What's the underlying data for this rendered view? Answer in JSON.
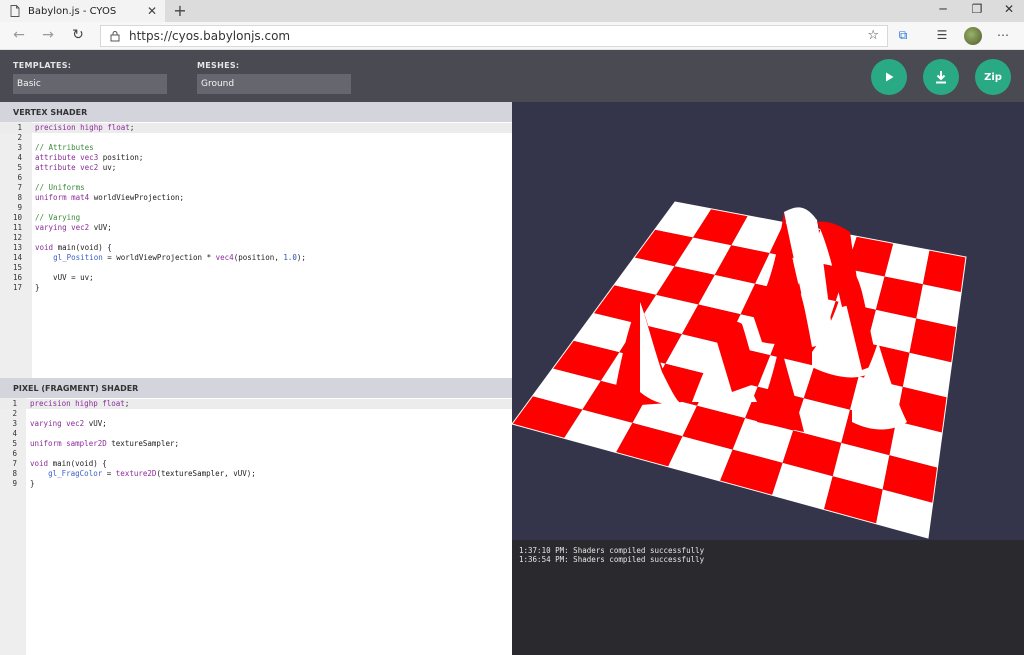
{
  "browser": {
    "tab_title": "Babylon.js - CYOS",
    "url": "https://cyos.babylonjs.com"
  },
  "header": {
    "templates_label": "TEMPLATES:",
    "templates_value": "Basic",
    "meshes_label": "MESHES:",
    "meshes_value": "Ground",
    "zip_label": "Zip"
  },
  "vertex": {
    "title": "VERTEX SHADER",
    "lines": [
      [
        {
          "t": "precision highp float",
          "c": "kw"
        },
        {
          "t": ";"
        }
      ],
      [],
      [
        {
          "t": "// Attributes",
          "c": "cm"
        }
      ],
      [
        {
          "t": "attribute vec3",
          "c": "kw"
        },
        {
          "t": " position;"
        }
      ],
      [
        {
          "t": "attribute vec2",
          "c": "kw"
        },
        {
          "t": " uv;"
        }
      ],
      [],
      [
        {
          "t": "// Uniforms",
          "c": "cm"
        }
      ],
      [
        {
          "t": "uniform mat4",
          "c": "kw"
        },
        {
          "t": " worldViewProjection;"
        }
      ],
      [],
      [
        {
          "t": "// Varying",
          "c": "cm"
        }
      ],
      [
        {
          "t": "varying vec2",
          "c": "kw"
        },
        {
          "t": " vUV;"
        }
      ],
      [],
      [
        {
          "t": "void",
          "c": "kw"
        },
        {
          "t": " main(void) {"
        }
      ],
      [
        {
          "t": "    "
        },
        {
          "t": "gl_Position",
          "c": "fn"
        },
        {
          "t": " = worldViewProjection * "
        },
        {
          "t": "vec4",
          "c": "kw"
        },
        {
          "t": "(position, "
        },
        {
          "t": "1.0",
          "c": "num"
        },
        {
          "t": ");"
        }
      ],
      [],
      [
        {
          "t": "    vUV = uv;"
        }
      ],
      [
        {
          "t": "}"
        }
      ]
    ]
  },
  "fragment": {
    "title": "PIXEL (FRAGMENT) SHADER",
    "lines": [
      [
        {
          "t": "precision highp float",
          "c": "kw"
        },
        {
          "t": ";"
        }
      ],
      [],
      [
        {
          "t": "varying vec2",
          "c": "kw"
        },
        {
          "t": " vUV;"
        }
      ],
      [],
      [
        {
          "t": "uniform sampler2D",
          "c": "kw"
        },
        {
          "t": " textureSampler;"
        }
      ],
      [],
      [
        {
          "t": "void",
          "c": "kw"
        },
        {
          "t": " main(void) {"
        }
      ],
      [
        {
          "t": "    "
        },
        {
          "t": "gl_FragColor",
          "c": "fn"
        },
        {
          "t": " = "
        },
        {
          "t": "texture2D",
          "c": "kw"
        },
        {
          "t": "(textureSampler, vUV);"
        }
      ],
      [
        {
          "t": "}"
        }
      ]
    ]
  },
  "console": {
    "lines": [
      "1:37:10 PM: Shaders compiled successfully",
      "1:36:54 PM: Shaders compiled successfully"
    ]
  },
  "colors": {
    "accent": "#2aa985",
    "viewport_bg": "#34344b",
    "checker_red": "#ff0000",
    "checker_white": "#ffffff"
  }
}
